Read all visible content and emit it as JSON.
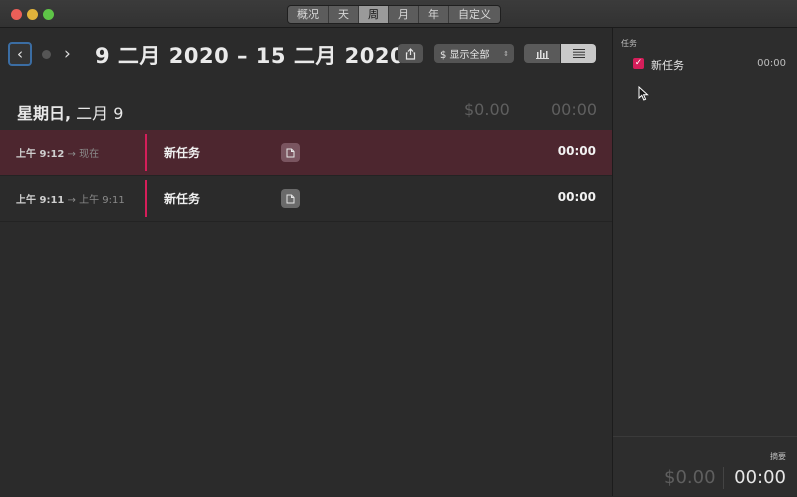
{
  "toolbar": {
    "segments": [
      "概况",
      "天",
      "周",
      "月",
      "年",
      "自定义"
    ],
    "active_segment": "周"
  },
  "header": {
    "range_title": "9 二月 2020 – 15 二月 2020",
    "filter_label": "$ 显示全部"
  },
  "day": {
    "title_bold": "星期日,",
    "title_rest": " 二月 9",
    "amount": "$0.00",
    "time": "00:00"
  },
  "entries": [
    {
      "start": "上午 9:12",
      "end": " → 现在",
      "name": "新任务",
      "duration": "00:00",
      "active": true
    },
    {
      "start": "上午 9:11",
      "end": " → 上午 9:11",
      "name": "新任务",
      "duration": "00:00",
      "active": false
    }
  ],
  "sidebar": {
    "tasks_label": "任务",
    "task": {
      "name": "新任务",
      "time": "00:00",
      "checked": true
    },
    "summary_label": "摘要",
    "summary_amount": "$0.00",
    "summary_time": "00:00"
  },
  "colors": {
    "accent": "#d51e5a",
    "active_row": "#4d262f",
    "focus_ring": "#3b6da3"
  },
  "icons": [
    "back-chevron-icon",
    "forward-chevron-icon",
    "share-icon",
    "bar-chart-icon",
    "list-icon",
    "note-icon",
    "checkbox-icon",
    "cursor-icon"
  ]
}
